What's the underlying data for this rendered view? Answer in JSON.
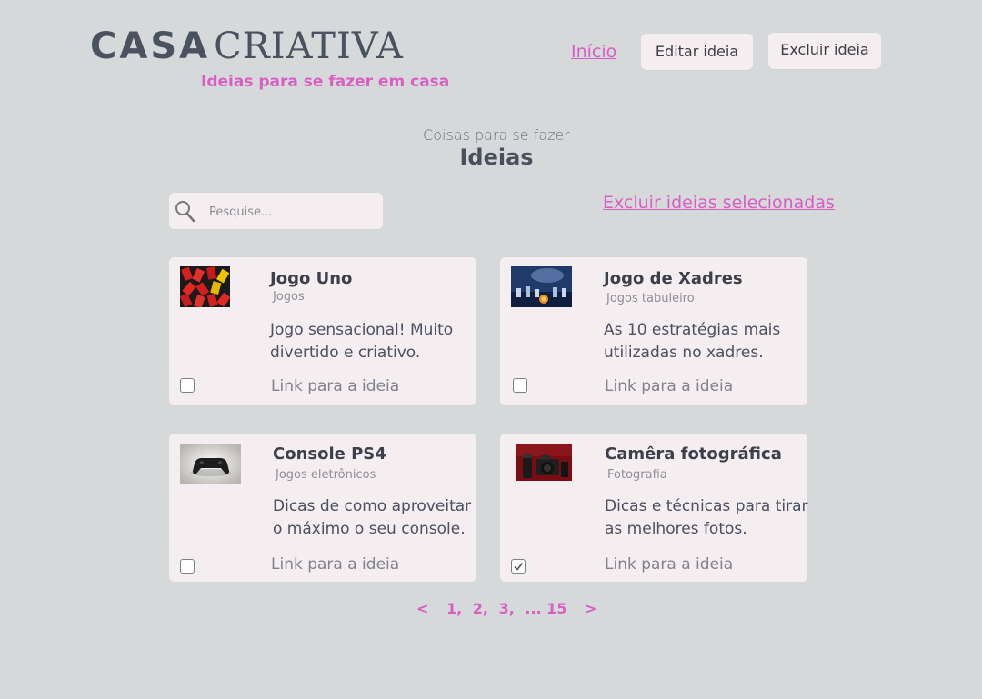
{
  "header": {
    "logo_part1": "CASA",
    "logo_part2": "CRIATIVA",
    "tagline": "Ideias para se fazer em casa",
    "nav_home": "Início",
    "edit_button": "Editar ideia",
    "delete_button": "Excluir ideia"
  },
  "section": {
    "subtitle": "Coisas para se fazer",
    "title": "Ideias"
  },
  "search": {
    "placeholder": "Pesquise...",
    "value": ""
  },
  "delete_selected": "Excluir ideias selecionadas",
  "cards": [
    {
      "title": "Jogo Uno",
      "category": "Jogos",
      "description": "Jogo sensacional! Muito divertido e criativo.",
      "link": "Link para a ideia",
      "checked": false
    },
    {
      "title": "Jogo de Xadres",
      "category": "Jogos tabuleiro",
      "description": "As 10 estratégias mais utilizadas no xadres.",
      "link": "Link para a ideia",
      "checked": false
    },
    {
      "title": "Console PS4",
      "category": "Jogos eletrônicos",
      "description": "Dicas de como aproveitar o máximo o seu console.",
      "link": "Link para a ideia",
      "checked": false
    },
    {
      "title": "Camêra fotográfica",
      "category": "Fotografia",
      "description": "Dicas e técnicas para tirar as melhores fotos.",
      "link": "Link para a ideia",
      "checked": true
    }
  ],
  "pagination": {
    "prev": "<",
    "pages": [
      "1,",
      "2,",
      "3,",
      "... 15"
    ],
    "next": ">"
  },
  "colors": {
    "background": "#d5d9da",
    "card": "#f5eef1",
    "accent": "#d85ec4",
    "text": "#4a4f5a"
  }
}
